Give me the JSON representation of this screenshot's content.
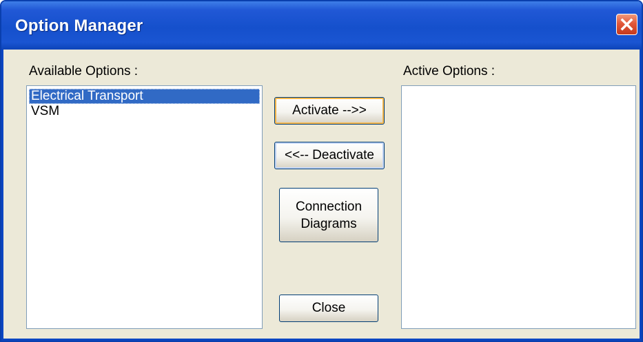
{
  "window": {
    "title": "Option Manager",
    "close_icon": "close-icon"
  },
  "available": {
    "label": "Available Options :",
    "items": [
      {
        "label": "Electrical Transport",
        "selected": true
      },
      {
        "label": "VSM",
        "selected": false
      }
    ]
  },
  "active": {
    "label": "Active Options :",
    "items": []
  },
  "buttons": {
    "activate": "Activate -->>",
    "deactivate": "<<-- Deactivate",
    "connection_line1": "Connection",
    "connection_line2": "Diagrams",
    "close": "Close"
  },
  "colors": {
    "titlebar": "#1550cc",
    "selection": "#316ac5",
    "dialog_bg": "#ece9d8",
    "close_button": "#e2583a"
  }
}
